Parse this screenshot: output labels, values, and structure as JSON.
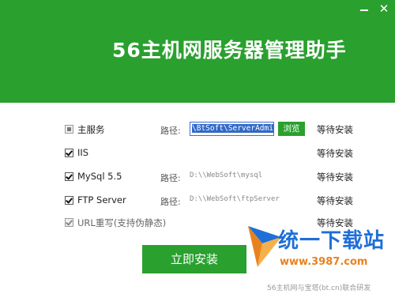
{
  "window": {
    "title": "56主机网服务器管理助手",
    "minimize": "–",
    "close": "✕"
  },
  "items": [
    {
      "label": "主服务",
      "state": "partial",
      "path_label": "路径:",
      "path_value": "\\BtSoft\\ServerAdmin",
      "browse": "浏览",
      "status": "等待安装"
    },
    {
      "label": "IIS",
      "state": "checked",
      "status": "等待安装"
    },
    {
      "label": "MySql 5.5",
      "state": "checked",
      "path_label": "路径:",
      "path_value": "D:\\\\WebSoft\\mysql",
      "status": "等待安装"
    },
    {
      "label": "FTP Server",
      "state": "checked",
      "path_label": "路径:",
      "path_value": "D:\\\\WebSoft\\ftpServer",
      "status": "等待安装"
    },
    {
      "label": "URL重写(支持伪静态)",
      "state": "checked-grey",
      "status": "等待安装"
    }
  ],
  "install_button": "立即安装",
  "footer": "56主机网与宝塔(bt.cn)联合研发",
  "watermark": {
    "brand": "统一下载站",
    "url": "www.3987.com"
  },
  "colors": {
    "accent": "#2aa02f",
    "selection": "#3169c6",
    "watermark_blue": "#1f6fd6",
    "watermark_orange": "#e8821f"
  }
}
